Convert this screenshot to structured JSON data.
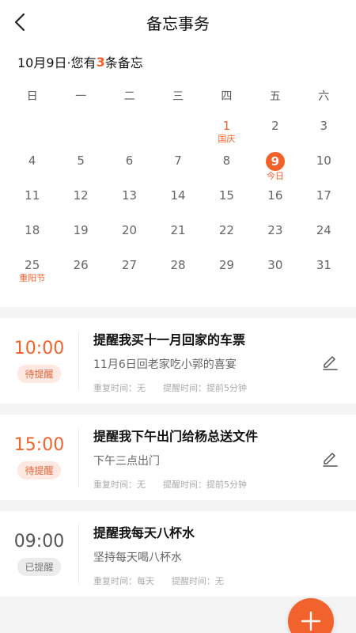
{
  "header": {
    "title": "备忘事务"
  },
  "summary": {
    "date": "10月9日",
    "prefix": "·您有",
    "count": "3",
    "suffix": "条备忘"
  },
  "calendar": {
    "weekdays": [
      "日",
      "一",
      "二",
      "三",
      "四",
      "五",
      "六"
    ],
    "days": [
      {
        "n": "1",
        "sub": "国庆",
        "holiday": true
      },
      {
        "n": "2"
      },
      {
        "n": "3"
      },
      {
        "n": "4"
      },
      {
        "n": "5"
      },
      {
        "n": "6"
      },
      {
        "n": "7"
      },
      {
        "n": "8"
      },
      {
        "n": "9",
        "sub": "今日",
        "today": true
      },
      {
        "n": "10"
      },
      {
        "n": "11"
      },
      {
        "n": "12"
      },
      {
        "n": "13"
      },
      {
        "n": "14"
      },
      {
        "n": "15"
      },
      {
        "n": "16"
      },
      {
        "n": "17"
      },
      {
        "n": "18"
      },
      {
        "n": "19"
      },
      {
        "n": "20"
      },
      {
        "n": "21"
      },
      {
        "n": "22"
      },
      {
        "n": "23"
      },
      {
        "n": "24"
      },
      {
        "n": "25",
        "sub": "重阳节"
      },
      {
        "n": "26"
      },
      {
        "n": "27"
      },
      {
        "n": "28"
      },
      {
        "n": "29"
      },
      {
        "n": "30"
      },
      {
        "n": "31"
      }
    ],
    "leading_blanks": 4
  },
  "reminders": [
    {
      "time": "10:00",
      "status": "待提醒",
      "done": false,
      "title": "提醒我买十一月回家的车票",
      "desc": "11月6日回老家吃小郭的喜宴",
      "repeat": "重复时间：无",
      "remind": "提醒时间：提前5分钟",
      "editable": true
    },
    {
      "time": "15:00",
      "status": "待提醒",
      "done": false,
      "title": "提醒我下午出门给杨总送文件",
      "desc": "下午三点出门",
      "repeat": "重复时间：无",
      "remind": "提醒时间：提前5分钟",
      "editable": true
    },
    {
      "time": "09:00",
      "status": "已提醒",
      "done": true,
      "title": "提醒我每天八杯水",
      "desc": "坚持每天喝八杯水",
      "repeat": "重复时间：每天",
      "remind": "提醒时间：无",
      "editable": false
    }
  ],
  "colors": {
    "accent": "#f2622c"
  },
  "icons": {
    "back": "chevron-left-icon",
    "edit": "pencil-icon",
    "add": "plus-icon"
  }
}
